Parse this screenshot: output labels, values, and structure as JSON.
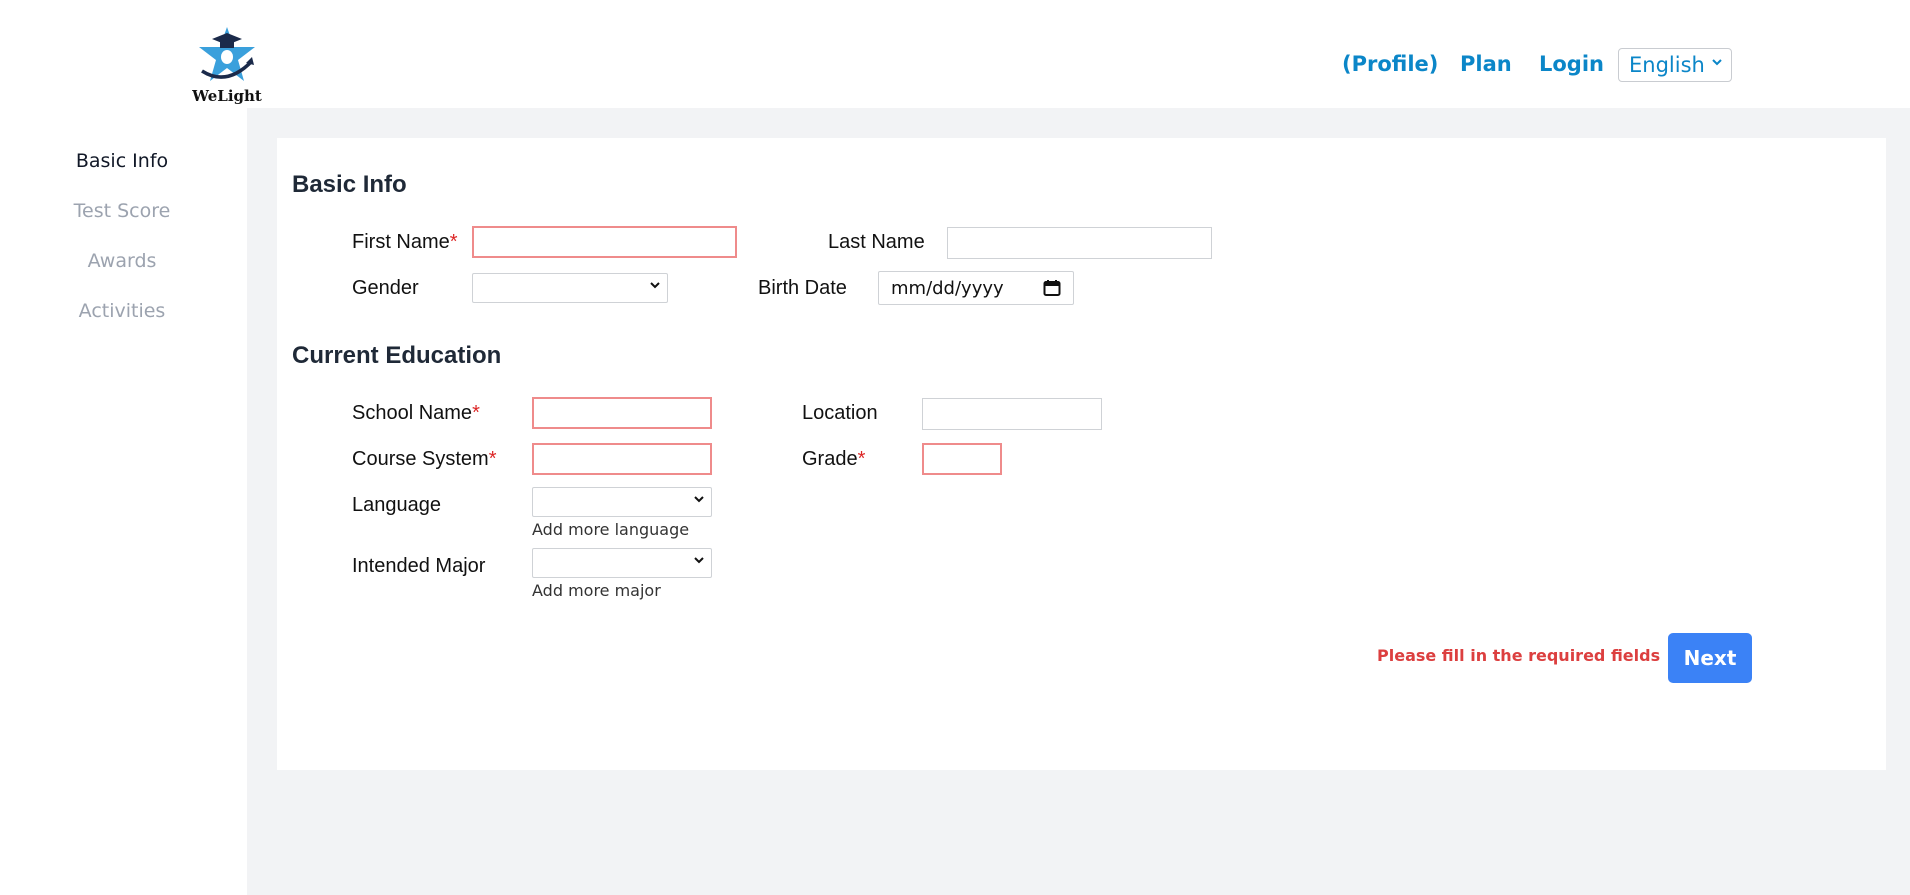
{
  "brand": {
    "name": "WeLight"
  },
  "nav": {
    "profile": "(Profile)",
    "plan": "Plan",
    "login": "Login",
    "language": "English"
  },
  "sidebar": {
    "items": [
      {
        "label": "Basic Info",
        "active": true
      },
      {
        "label": "Test Score",
        "active": false
      },
      {
        "label": "Awards",
        "active": false
      },
      {
        "label": "Activities",
        "active": false
      }
    ]
  },
  "form": {
    "basic_info_title": "Basic Info",
    "first_name": {
      "label": "First Name",
      "required": "*",
      "value": ""
    },
    "last_name": {
      "label": "Last Name",
      "value": ""
    },
    "gender": {
      "label": "Gender",
      "value": ""
    },
    "birth_date": {
      "label": "Birth Date",
      "placeholder": "mm/dd/yyyy"
    },
    "education_title": "Current Education",
    "school_name": {
      "label": "School Name",
      "required": "*",
      "value": ""
    },
    "location": {
      "label": "Location",
      "value": ""
    },
    "course_system": {
      "label": "Course System",
      "required": "*",
      "value": ""
    },
    "grade": {
      "label": "Grade",
      "required": "*",
      "value": ""
    },
    "language": {
      "label": "Language",
      "value": "",
      "add_more": "Add more language"
    },
    "intended_major": {
      "label": "Intended Major",
      "value": "",
      "add_more": "Add more major"
    }
  },
  "footer": {
    "error": "Please fill in the required fields",
    "next": "Next"
  },
  "colors": {
    "accent": "#0b86c8",
    "primary_button": "#3b82f6",
    "error": "#dc3f3f",
    "required": "#dc2626"
  }
}
